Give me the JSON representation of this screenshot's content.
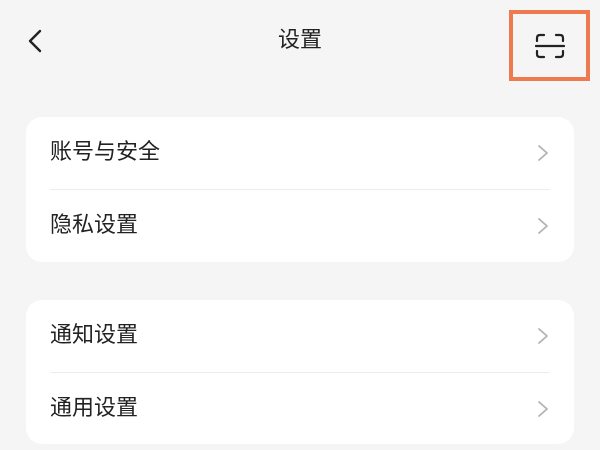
{
  "header": {
    "title": "设置",
    "back_icon": "chevron-left-icon",
    "scan_icon": "scan-icon",
    "highlight_color": "#f07a50"
  },
  "groups": [
    {
      "items": [
        {
          "label": "账号与安全",
          "icon": "chevron-right-icon"
        },
        {
          "label": "隐私设置",
          "icon": "chevron-right-icon"
        }
      ]
    },
    {
      "items": [
        {
          "label": "通知设置",
          "icon": "chevron-right-icon"
        },
        {
          "label": "通用设置",
          "icon": "chevron-right-icon"
        }
      ]
    }
  ]
}
